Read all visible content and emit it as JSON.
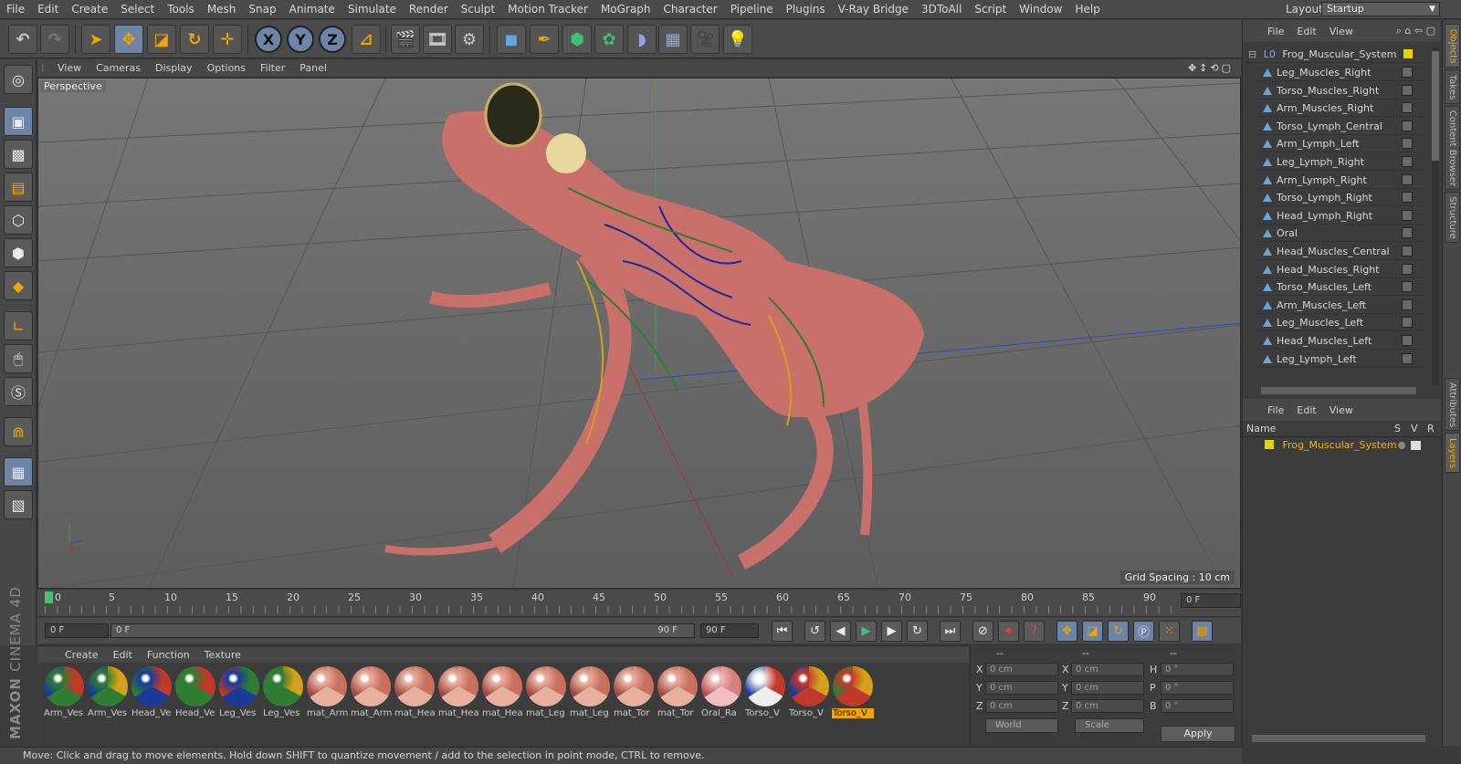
{
  "menubar": [
    "File",
    "Edit",
    "Create",
    "Select",
    "Tools",
    "Mesh",
    "Snap",
    "Animate",
    "Simulate",
    "Render",
    "Sculpt",
    "Motion Tracker",
    "MoGraph",
    "Character",
    "Pipeline",
    "Plugins",
    "V-Ray Bridge",
    "3DToAll",
    "Script",
    "Window",
    "Help"
  ],
  "layout": {
    "label": "Layout:",
    "value": "Startup"
  },
  "toolbar_axes": {
    "x": "X",
    "y": "Y",
    "z": "Z"
  },
  "viewport": {
    "menu": [
      "View",
      "Cameras",
      "Display",
      "Options",
      "Filter",
      "Panel"
    ],
    "camera": "Perspective",
    "grid_spacing": "Grid Spacing : 10 cm"
  },
  "timeline": {
    "ticks": [
      "0",
      "5",
      "10",
      "15",
      "20",
      "25",
      "30",
      "35",
      "40",
      "45",
      "50",
      "55",
      "60",
      "65",
      "70",
      "75",
      "80",
      "85",
      "90"
    ],
    "frame_right": "0 F"
  },
  "transport": {
    "current": "0 F",
    "range_start": "0 F",
    "range_end": "90 F",
    "max": "90 F"
  },
  "materials": {
    "menu": [
      "Create",
      "Edit",
      "Function",
      "Texture"
    ],
    "items": [
      {
        "label": "Arm_Ves",
        "c1": "#c0392b",
        "c2": "#2e7d32",
        "c3": "#1a3a9a"
      },
      {
        "label": "Arm_Ves",
        "c1": "#d4a017",
        "c2": "#2e7d32",
        "c3": "#1a3a9a"
      },
      {
        "label": "Head_Ve",
        "c1": "#c0392b",
        "c2": "#1a3a9a",
        "c3": "#2e7d32"
      },
      {
        "label": "Head_Ve",
        "c1": "#c0392b",
        "c2": "#2e7d32",
        "c3": "#2e7d32"
      },
      {
        "label": "Leg_Ves",
        "c1": "#2e7d32",
        "c2": "#1a3a9a",
        "c3": "#c0392b"
      },
      {
        "label": "Leg_Ves",
        "c1": "#d4a017",
        "c2": "#2e7d32",
        "c3": "#2e7d32"
      },
      {
        "label": "mat_Arm",
        "c1": "#c97060",
        "c2": "#e8b0a0",
        "c3": "#a04a40"
      },
      {
        "label": "mat_Arm",
        "c1": "#c97060",
        "c2": "#e8b0a0",
        "c3": "#a04a40"
      },
      {
        "label": "mat_Hea",
        "c1": "#c97060",
        "c2": "#e8b0a0",
        "c3": "#a04a40"
      },
      {
        "label": "mat_Hea",
        "c1": "#c97060",
        "c2": "#e8b0a0",
        "c3": "#a04a40"
      },
      {
        "label": "mat_Hea",
        "c1": "#c97060",
        "c2": "#e8b0a0",
        "c3": "#a04a40"
      },
      {
        "label": "mat_Leg",
        "c1": "#c97060",
        "c2": "#e8b0a0",
        "c3": "#a04a40"
      },
      {
        "label": "mat_Leg",
        "c1": "#c97060",
        "c2": "#e8b0a0",
        "c3": "#a04a40"
      },
      {
        "label": "mat_Tor",
        "c1": "#c97060",
        "c2": "#e8b0a0",
        "c3": "#a04a40"
      },
      {
        "label": "mat_Tor",
        "c1": "#c97060",
        "c2": "#e8b0a0",
        "c3": "#a04a40"
      },
      {
        "label": "Oral_Ra",
        "c1": "#d88080",
        "c2": "#f0c0c0",
        "c3": "#b05050"
      },
      {
        "label": "Torso_V",
        "c1": "#c0392b",
        "c2": "#eeeeee",
        "c3": "#1a3a9a"
      },
      {
        "label": "Torso_V",
        "c1": "#d4a017",
        "c2": "#c0392b",
        "c3": "#1a3a9a"
      },
      {
        "label": "Torso_V",
        "c1": "#d4a017",
        "c2": "#c0392b",
        "c3": "#2e7d32"
      }
    ]
  },
  "coords": {
    "col1": "--",
    "col2": "--",
    "col3": "--",
    "rows": [
      {
        "a": "X",
        "av": "0 cm",
        "b": "X",
        "bv": "0 cm",
        "c": "H",
        "cv": "0 °"
      },
      {
        "a": "Y",
        "av": "0 cm",
        "b": "Y",
        "bv": "0 cm",
        "c": "P",
        "cv": "0 °"
      },
      {
        "a": "Z",
        "av": "0 cm",
        "b": "Z",
        "bv": "0 cm",
        "c": "B",
        "cv": "0 °"
      }
    ],
    "mode1": "World",
    "mode2": "Scale",
    "apply": "Apply"
  },
  "logo": {
    "line1": "MAXON",
    "line2": "CINEMA 4D"
  },
  "status": "Move: Click and drag to move elements. Hold down SHIFT to quantize movement / add to the selection in point mode, CTRL to remove.",
  "objects": {
    "menu": [
      "File",
      "Edit",
      "View"
    ],
    "root": "Frog_Muscular_System",
    "items": [
      "Leg_Muscles_Right",
      "Torso_Muscles_Right",
      "Arm_Muscles_Right",
      "Torso_Lymph_Central",
      "Arm_Lymph_Left",
      "Leg_Lymph_Right",
      "Arm_Lymph_Right",
      "Torso_Lymph_Right",
      "Head_Lymph_Right",
      "Oral",
      "Head_Muscles_Central",
      "Head_Muscles_Right",
      "Torso_Muscles_Left",
      "Arm_Muscles_Left",
      "Leg_Muscles_Left",
      "Head_Muscles_Left",
      "Leg_Lymph_Left"
    ]
  },
  "layers": {
    "menu": [
      "File",
      "Edit",
      "View"
    ],
    "col_name": "Name",
    "col_s": "S",
    "col_v": "V",
    "col_r": "R",
    "row": "Frog_Muscular_System"
  },
  "sidetabs": [
    "Objects",
    "Takes",
    "Content Browser",
    "Structure",
    "Attributes",
    "Layers"
  ]
}
